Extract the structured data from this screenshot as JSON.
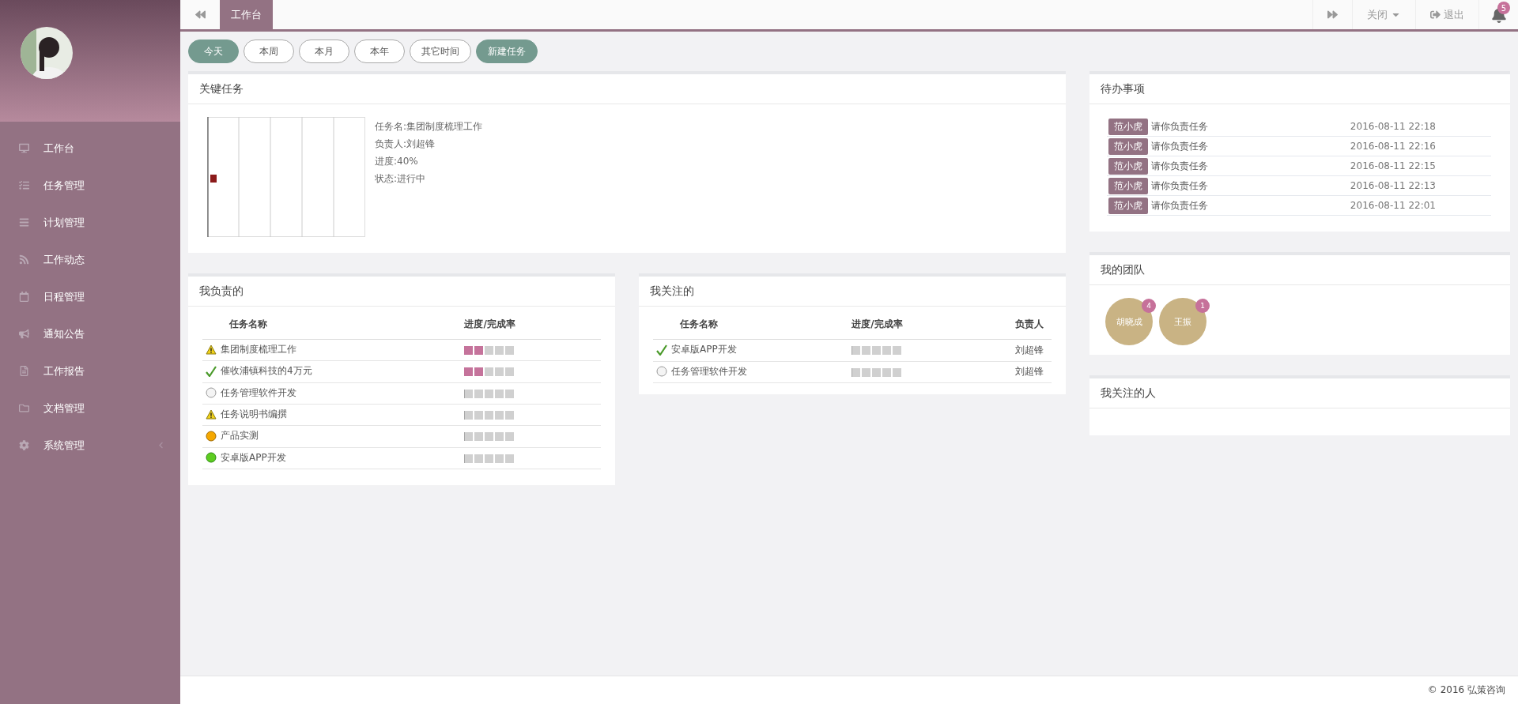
{
  "sidebar": {
    "items": [
      {
        "label": "工作台",
        "kind": "link"
      },
      {
        "label": "任务管理",
        "kind": "link"
      },
      {
        "label": "计划管理",
        "kind": "link"
      },
      {
        "label": "工作动态",
        "kind": "link"
      },
      {
        "label": "日程管理",
        "kind": "link"
      },
      {
        "label": "通知公告",
        "kind": "link"
      },
      {
        "label": "工作报告",
        "kind": "link"
      },
      {
        "label": "文档管理",
        "kind": "link"
      },
      {
        "label": "系统管理",
        "kind": "group"
      }
    ]
  },
  "topbar": {
    "tabs": [
      {
        "label": "工作台",
        "selected": true
      }
    ],
    "close_menu": "关闭",
    "logout": "退出",
    "notifications": "5"
  },
  "filters": [
    {
      "label": "今天",
      "selected": true
    },
    {
      "label": "本周",
      "selected": false
    },
    {
      "label": "本月",
      "selected": false
    },
    {
      "label": "本年",
      "selected": false
    },
    {
      "label": "其它时间",
      "selected": false
    }
  ],
  "new_task": "新建任务",
  "key_task": {
    "title": "关键任务",
    "details": [
      "任务名:集团制度梳理工作",
      "负责人:刘超锋",
      "进度:40%",
      "状态:进行中"
    ]
  },
  "my_tasks": {
    "title": "我负责的",
    "columns": [
      "任务名称",
      "进度/完成率"
    ],
    "rows": [
      {
        "kind": "warning",
        "name": "集团制度梳理工作",
        "level": 0.4
      },
      {
        "kind": "done",
        "name": "催收浦镇科技的4万元",
        "level": 0.4
      },
      {
        "kind": "pending",
        "name": "任务管理软件开发",
        "level": 0
      },
      {
        "kind": "warning",
        "name": "任务说明书编撰",
        "level": 0
      },
      {
        "kind": "orange",
        "name": "产品实测",
        "level": 0
      },
      {
        "kind": "green",
        "name": "安卓版APP开发",
        "level": 0
      }
    ]
  },
  "followed_tasks": {
    "title": "我关注的",
    "columns": [
      "任务名称",
      "进度/完成率",
      "负责人"
    ],
    "rows": [
      {
        "kind": "done",
        "name": "安卓版APP开发",
        "level": 0,
        "owner": "刘超锋"
      },
      {
        "kind": "pending",
        "name": "任务管理软件开发",
        "level": 0,
        "owner": "刘超锋"
      }
    ]
  },
  "todo": {
    "title": "待办事项",
    "items": [
      {
        "from": "范小虎",
        "text": "请你负责任务",
        "time": "2016-08-11 22:18"
      },
      {
        "from": "范小虎",
        "text": "请你负责任务",
        "time": "2016-08-11 22:16"
      },
      {
        "from": "范小虎",
        "text": "请你负责任务",
        "time": "2016-08-11 22:15"
      },
      {
        "from": "范小虎",
        "text": "请你负责任务",
        "time": "2016-08-11 22:13"
      },
      {
        "from": "范小虎",
        "text": "请你负责任务",
        "time": "2016-08-11 22:01"
      }
    ]
  },
  "team": {
    "title": "我的团队",
    "members": [
      {
        "name": "胡晓成",
        "count": "4"
      },
      {
        "name": "王振",
        "count": "1"
      }
    ]
  },
  "following": {
    "title": "我关注的人"
  },
  "footer": "© 2016 弘策咨询"
}
